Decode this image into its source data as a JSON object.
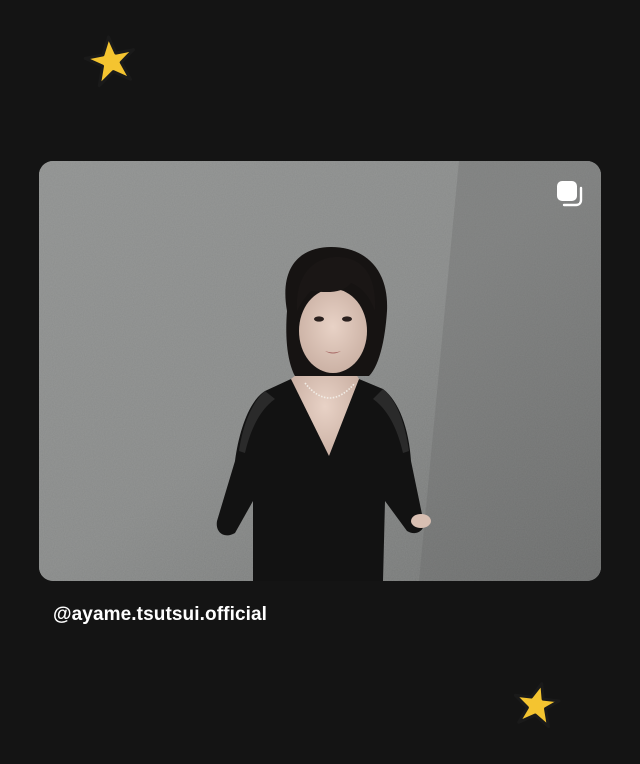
{
  "post": {
    "username": "@ayame.tsutsui.official",
    "is_multi_image": true
  },
  "decorations": {
    "star_color": "#f4c430",
    "star_outline": "#1a1a1a"
  },
  "icons": {
    "multi_image": "stacked-squares-icon",
    "star": "star-icon"
  },
  "colors": {
    "background": "#141414",
    "username_text": "#ffffff",
    "wall": "#8b8d8c"
  }
}
